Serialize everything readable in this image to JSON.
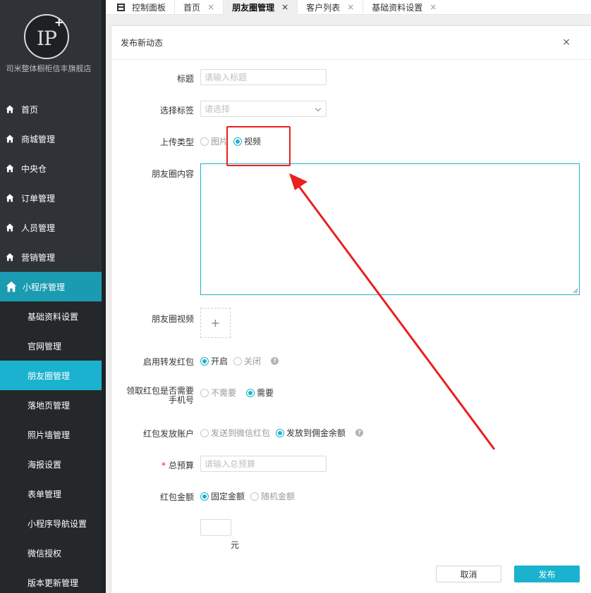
{
  "sidebar": {
    "logo_text": "IP",
    "logo_plus": "+",
    "store_name": "司米整体橱柜信丰旗舰店",
    "items": [
      {
        "label": "首页"
      },
      {
        "label": "商城管理"
      },
      {
        "label": "中央仓"
      },
      {
        "label": "订单管理"
      },
      {
        "label": "人员管理"
      },
      {
        "label": "营销管理"
      },
      {
        "label": "小程序管理"
      }
    ],
    "subitems": [
      {
        "label": "基础资料设置"
      },
      {
        "label": "官网管理"
      },
      {
        "label": "朋友圈管理"
      },
      {
        "label": "落地页管理"
      },
      {
        "label": "照片墙管理"
      },
      {
        "label": "海报设置"
      },
      {
        "label": "表单管理"
      },
      {
        "label": "小程序导航设置"
      },
      {
        "label": "微信授权"
      },
      {
        "label": "版本更新管理"
      }
    ]
  },
  "tabs": [
    {
      "label": "控制面板"
    },
    {
      "label": "首页",
      "close": "×"
    },
    {
      "label": "朋友圈管理",
      "close": "×"
    },
    {
      "label": "客户列表",
      "close": "×"
    },
    {
      "label": "基础资料设置",
      "close": "×"
    }
  ],
  "dialog": {
    "title": "发布新动态",
    "close": "×",
    "fields": {
      "title": {
        "label": "标题",
        "placeholder": "请输入标题"
      },
      "tag": {
        "label": "选择标签",
        "placeholder": "请选择"
      },
      "upload_type": {
        "label": "上传类型",
        "options": [
          "图片",
          "视频"
        ],
        "selected": "视频"
      },
      "content": {
        "label": "朋友圈内容",
        "value": ""
      },
      "video": {
        "label": "朋友圈视频",
        "plus": "+"
      },
      "redpacket_enable": {
        "label": "启用转发红包",
        "options": [
          "开启",
          "关闭"
        ],
        "selected": "开启",
        "help": "?"
      },
      "need_phone": {
        "label_line1": "领取红包是否需要",
        "label_line2": "手机号",
        "options": [
          "不需要",
          "需要"
        ],
        "selected": "需要"
      },
      "account": {
        "label": "红包发放账户",
        "options": [
          "发送到微信红包",
          "发放到佣金余额"
        ],
        "selected": "发放到佣金余额",
        "help": "?"
      },
      "budget": {
        "required_mark": "*",
        "label": "总预算",
        "placeholder": "请输入总预算"
      },
      "amount_type": {
        "label": "红包金额",
        "options": [
          "固定金额",
          "随机金额"
        ],
        "selected": "固定金额"
      },
      "amount": {
        "value": "",
        "unit": "元"
      }
    },
    "buttons": {
      "cancel": "取消",
      "submit": "发布"
    }
  },
  "colors": {
    "accent": "#1ab2cf",
    "sidebar_bg": "#2f3337",
    "annotation": "#e82020"
  }
}
